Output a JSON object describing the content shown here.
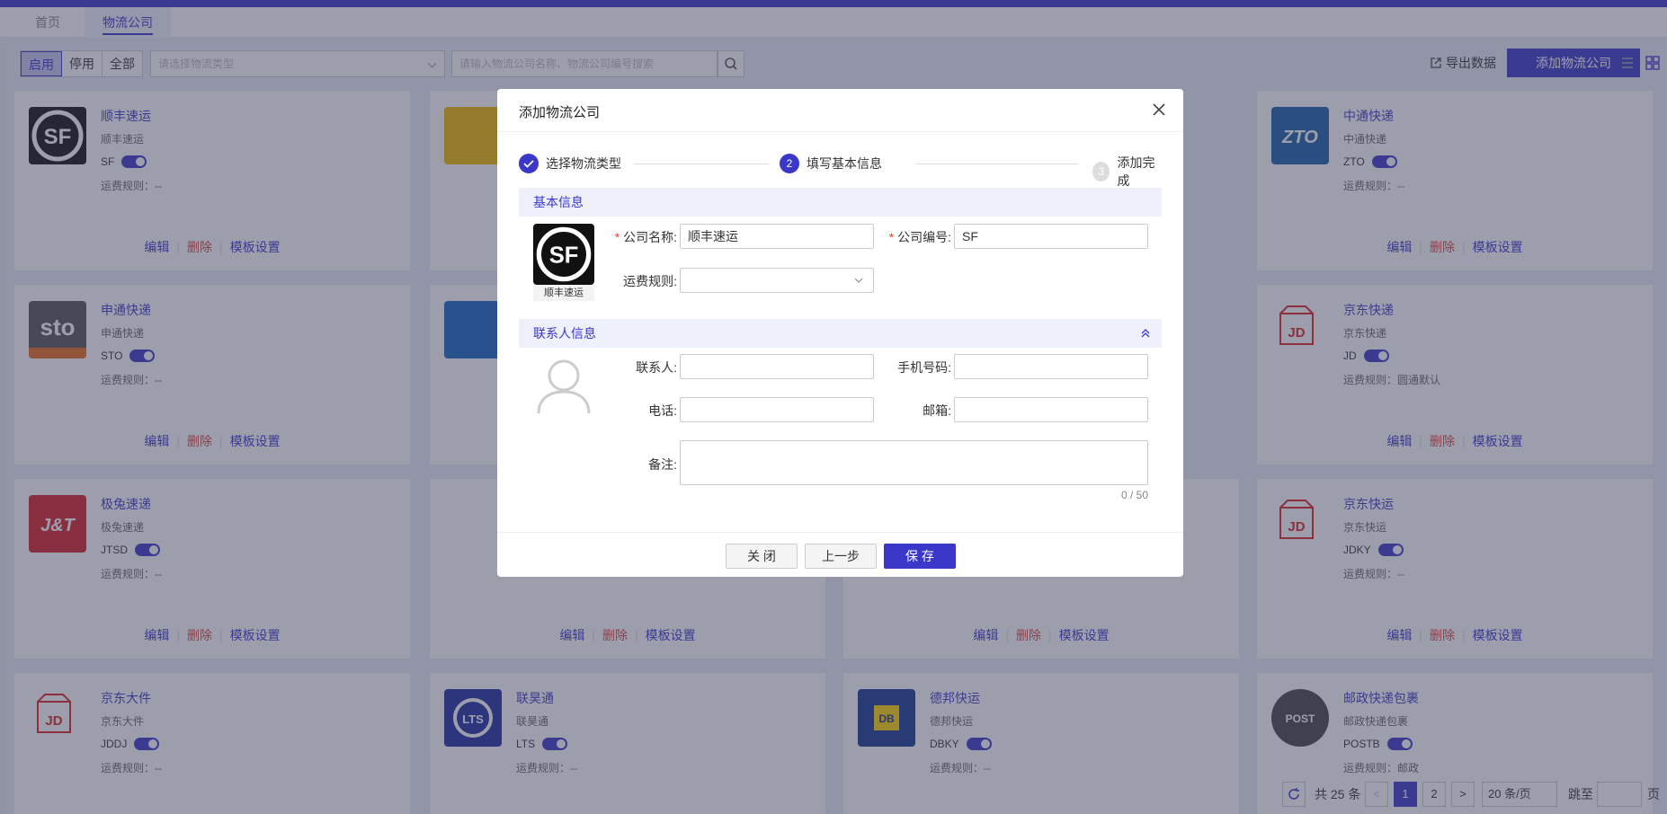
{
  "tabs": [
    {
      "label": "首页"
    },
    {
      "label": "物流公司"
    }
  ],
  "toolbar": {
    "status_filters": [
      "启用",
      "停用",
      "全部"
    ],
    "type_placeholder": "请选择物流类型",
    "search_placeholder": "请输入物流公司名称、物流公司编号搜索",
    "export_label": "导出数据",
    "add_label": "添加物流公司"
  },
  "card_actions": {
    "edit": "编辑",
    "delete": "删除",
    "template": "模板设置"
  },
  "cards": [
    {
      "name": "顺丰速运",
      "sub": "顺丰速运",
      "code": "SF",
      "rule": "运费规则：--",
      "logo_text": "SF"
    },
    {
      "name": "中通快递",
      "sub": "中通快递",
      "code": "ZTO",
      "rule": "运费规则：--",
      "logo_text": "ZTO"
    },
    {
      "name": "申通快递",
      "sub": "申通快递",
      "code": "STO",
      "rule": "运费规则：--",
      "logo_text": "sto"
    },
    {
      "name": "京东快递",
      "sub": "京东快递",
      "code": "JD",
      "rule": "运费规则：圆通默认",
      "logo_text": "JD"
    },
    {
      "name": "极兔速递",
      "sub": "极兔速递",
      "code": "JTSD",
      "rule": "运费规则：--",
      "logo_text": "J&T"
    },
    {
      "name": "京东快运",
      "sub": "京东快运",
      "code": "JDKY",
      "rule": "运费规则：--",
      "logo_text": "JD"
    },
    {
      "name": "京东大件",
      "sub": "京东大件",
      "code": "JDDJ",
      "rule": "运费规则：--",
      "logo_text": "JD"
    },
    {
      "name": "联昊通",
      "sub": "联昊通",
      "code": "LTS",
      "rule": "运费规则：--",
      "logo_text": "LTS"
    },
    {
      "name": "德邦快运",
      "sub": "德邦快运",
      "code": "DBKY",
      "rule": "运费规则：--",
      "logo_text": "DB"
    },
    {
      "name": "邮政快递包裹",
      "sub": "邮政快递包裹",
      "code": "POSTB",
      "rule": "运费规则：邮政",
      "logo_text": "POST"
    }
  ],
  "modal": {
    "title": "添加物流公司",
    "steps": [
      "选择物流类型",
      "填写基本信息",
      "添加完成"
    ],
    "step_numbers": [
      "2",
      "3"
    ],
    "section_basic": "基本信息",
    "logo_caption": "顺丰速运",
    "company_name_label": "公司名称:",
    "company_name_value": "顺丰速运",
    "company_code_label": "公司编号:",
    "company_code_value": "SF",
    "freight_rule_label": "运费规则:",
    "section_contact": "联系人信息",
    "contact_label": "联系人:",
    "mobile_label": "手机号码:",
    "phone_label": "电话:",
    "email_label": "邮箱:",
    "remark_label": "备注:",
    "remark_count": "0 / 50",
    "btn_close": "关 闭",
    "btn_prev": "上一步",
    "btn_save": "保 存"
  },
  "pagination": {
    "total": "共 25 条",
    "pages": [
      "1",
      "2"
    ],
    "page_size": "20 条/页",
    "jump_label": "跳至",
    "page_unit": "页"
  },
  "colors": {
    "accent": "#3a37c9",
    "danger": "#e0423d"
  }
}
